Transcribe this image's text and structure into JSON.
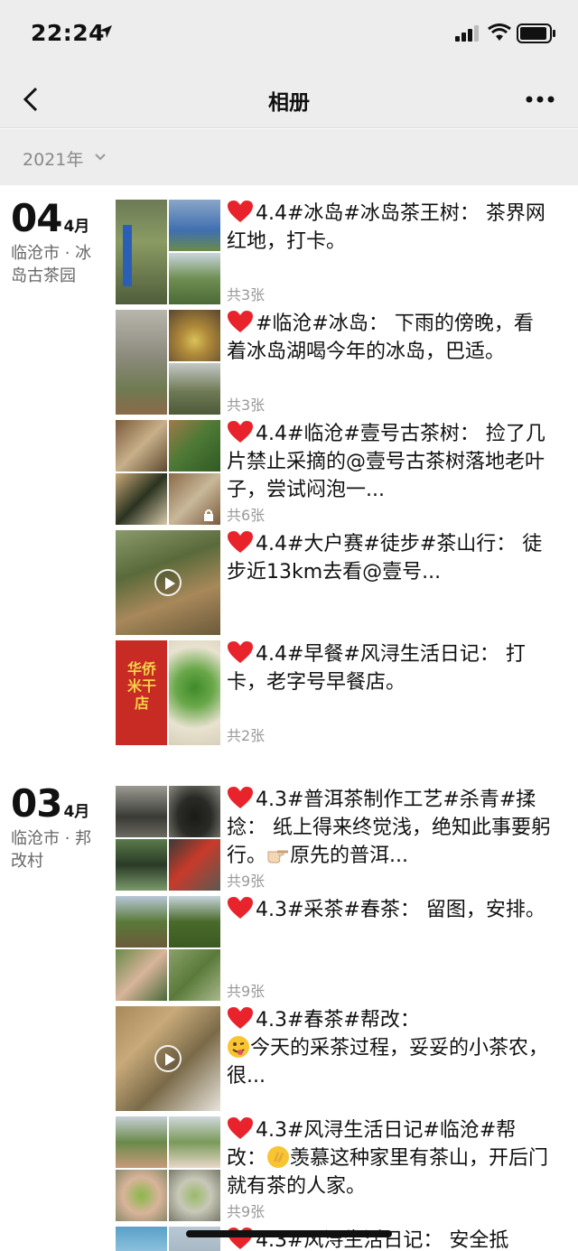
{
  "status_bar": {
    "time": "22:24"
  },
  "nav": {
    "title": "相册"
  },
  "year_filter": {
    "label": "2021年"
  },
  "groups": [
    {
      "day": "04",
      "month": "4月",
      "place_line1": "临沧市 · 冰",
      "place_line2": "岛古茶园",
      "posts": [
        {
          "text": "4.4#冰岛#冰岛茶王树： 茶界网红地，打卡。",
          "count": "共3张"
        },
        {
          "text": "#临沧#冰岛： 下雨的傍晚，看着冰岛湖喝今年的冰岛，巴适。",
          "count": "共3张"
        },
        {
          "text": "4.4#临沧#壹号古茶树： 捡了几片禁止采摘的@壹号古茶树落地老叶子，尝试闷泡一...",
          "count": "共6张"
        },
        {
          "text": "4.4#大户赛#徒步#茶山行： 徒步近13km去看@壹号...",
          "count": ""
        },
        {
          "text": "4.4#早餐#风浔生活日记： 打卡，老字号早餐店。",
          "count": "共2张",
          "thumb_sign_text": "华侨米干店"
        }
      ]
    },
    {
      "day": "03",
      "month": "4月",
      "place_line1": "临沧市 · 邦",
      "place_line2": "改村",
      "posts": [
        {
          "text": "4.3#普洱茶制作工艺#杀青#揉捻： 纸上得来终觉浅，绝知此事要躬行。",
          "text_after_emoji": "原先的普洱...",
          "count": "共9张"
        },
        {
          "text": "4.3#采茶#春茶： 留图，安排。",
          "count": "共9张"
        },
        {
          "text": "4.3#春茶#帮改：",
          "text_after_emoji": "今天的采茶过程，妥妥的小茶农，很...",
          "count": ""
        },
        {
          "text": "4.3#风浔生活日记#临沧#帮改：",
          "text_after_emoji": "羡慕这种家里有茶山，开后门就有茶的人家。",
          "count": "共9张"
        },
        {
          "text": "4.3#风浔生活日记： 安全抵",
          "count": ""
        }
      ]
    }
  ],
  "colors": {
    "heart": "#e8232b",
    "gray_text": "#999999",
    "bar_bg": "#ededed"
  }
}
